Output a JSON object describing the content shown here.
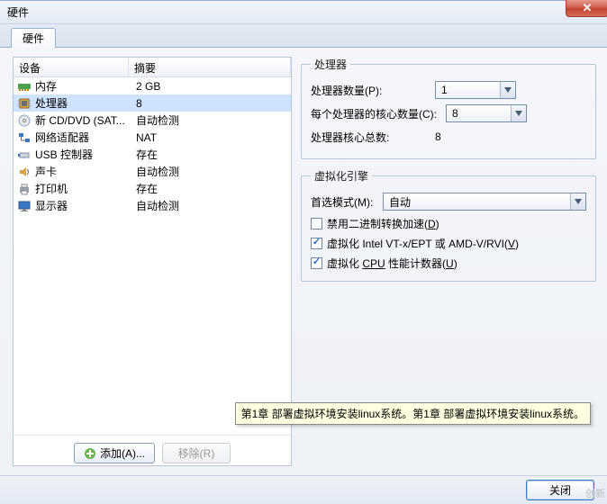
{
  "window": {
    "title": "硬件",
    "close_glyph": "✕"
  },
  "tabs": [
    {
      "label": "硬件"
    }
  ],
  "device_panel": {
    "header_device": "设备",
    "header_summary": "摘要",
    "items": [
      {
        "icon": "memory-icon",
        "name": "内存",
        "summary": "2 GB",
        "selected": false
      },
      {
        "icon": "cpu-icon",
        "name": "处理器",
        "summary": "8",
        "selected": true
      },
      {
        "icon": "disc-icon",
        "name": "新 CD/DVD (SAT...",
        "summary": "自动检测",
        "selected": false
      },
      {
        "icon": "network-icon",
        "name": "网络适配器",
        "summary": "NAT",
        "selected": false
      },
      {
        "icon": "usb-icon",
        "name": "USB 控制器",
        "summary": "存在",
        "selected": false
      },
      {
        "icon": "sound-icon",
        "name": "声卡",
        "summary": "自动检测",
        "selected": false
      },
      {
        "icon": "printer-icon",
        "name": "打印机",
        "summary": "存在",
        "selected": false
      },
      {
        "icon": "display-icon",
        "name": "显示器",
        "summary": "自动检测",
        "selected": false
      }
    ],
    "add_label": "添加(A)...",
    "remove_label": "移除(R)"
  },
  "processor_group": {
    "legend": "处理器",
    "count_label": "处理器数量(P):",
    "count_value": "1",
    "cores_label": "每个处理器的核心数量(C):",
    "cores_value": "8",
    "total_label": "处理器核心总数:",
    "total_value": "8"
  },
  "virt_group": {
    "legend": "虚拟化引擎",
    "mode_label": "首选模式(M):",
    "mode_value": "自动",
    "checkboxes": [
      {
        "checked": false,
        "label_pre": "禁用二进制转换加速(",
        "mne": "D",
        "label_post": ")"
      },
      {
        "checked": true,
        "label_pre": "虚拟化 Intel VT-x/EPT 或 AMD-V/RVI(",
        "mne": "V",
        "label_post": ")"
      },
      {
        "checked": true,
        "label_pre": "虚拟化 ",
        "underline_mid": "CPU",
        "mid_rest": " 性能计数器(",
        "mne": "U",
        "label_post": ")"
      }
    ]
  },
  "tooltip_text": "第1章 部署虚拟环境安装linux系统。第1章 部署虚拟环境安装linux系统。",
  "footer": {
    "close_label": "关闭"
  },
  "watermark": "创新"
}
